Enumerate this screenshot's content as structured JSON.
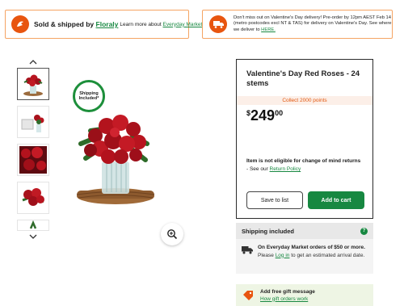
{
  "banners": {
    "sold_prefix": "Sold & shipped by ",
    "seller": "Floraly",
    "learn_prefix": "Learn more about ",
    "learn_link": "Everyday Market",
    "notice_text": "Don't miss out on Valentine's Day delivery! Pre-order by 12pm AEST Feb 14 (metro postcodes excl NT & TAS) for delivery on Valentine's Day. See where we deliver to ",
    "notice_link": "HERE."
  },
  "gallery": {
    "badge_line1": "Shipping",
    "badge_line2": "Included*"
  },
  "product": {
    "title": "Valentine's Day Red Roses - 24 stems",
    "points": "Collect 2000 points",
    "price_symbol": "$",
    "price_whole": "249",
    "price_cents": "00",
    "no_return": "Item is not eligible for change of mind returns",
    "policy_prefix": "- See our ",
    "policy_link": "Return Policy",
    "save_label": "Save to list",
    "cart_label": "Add to cart"
  },
  "shipping": {
    "title": "Shipping included",
    "bold_text": "On Everyday Market orders of $50 or more.",
    "please": "Please ",
    "login_link": "Log in",
    "rest": " to get an estimated arrival date."
  },
  "gift": {
    "title": "Add free gift message",
    "link": "How gift orders work"
  },
  "colors": {
    "accent_green": "#178841",
    "accent_orange": "#e8550f",
    "banner_border": "#f5a463"
  },
  "icons": [
    "floraly-logo-icon",
    "delivery-truck-icon",
    "chevron-up-icon",
    "chevron-down-icon",
    "zoom-in-icon",
    "help-icon",
    "truck-icon",
    "gift-tag-icon"
  ]
}
